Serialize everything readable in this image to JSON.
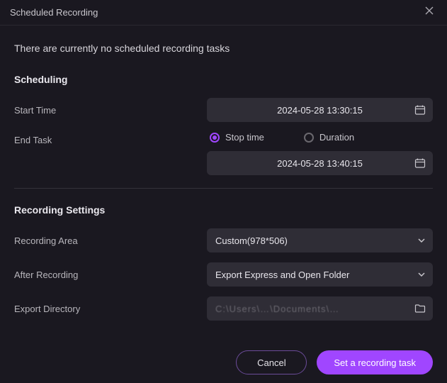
{
  "window": {
    "title": "Scheduled Recording"
  },
  "status": {
    "message": "There are currently no scheduled recording tasks"
  },
  "scheduling": {
    "heading": "Scheduling",
    "start_time_label": "Start Time",
    "start_time_value": "2024-05-28 13:30:15",
    "end_task_label": "End Task",
    "radio_stop_time": "Stop time",
    "radio_duration": "Duration",
    "end_task_mode": "stop_time",
    "stop_time_value": "2024-05-28 13:40:15"
  },
  "recording_settings": {
    "heading": "Recording Settings",
    "recording_area_label": "Recording Area",
    "recording_area_value": "Custom(978*506)",
    "after_recording_label": "After Recording",
    "after_recording_value": "Export Express and Open Folder",
    "export_directory_label": "Export Directory",
    "export_directory_value": "C:\\Users\\…\\Documents\\…"
  },
  "footer": {
    "cancel_label": "Cancel",
    "primary_label": "Set a recording task"
  },
  "colors": {
    "accent": "#a046ff",
    "bg": "#1a1820",
    "field_bg": "#2f2d36"
  }
}
